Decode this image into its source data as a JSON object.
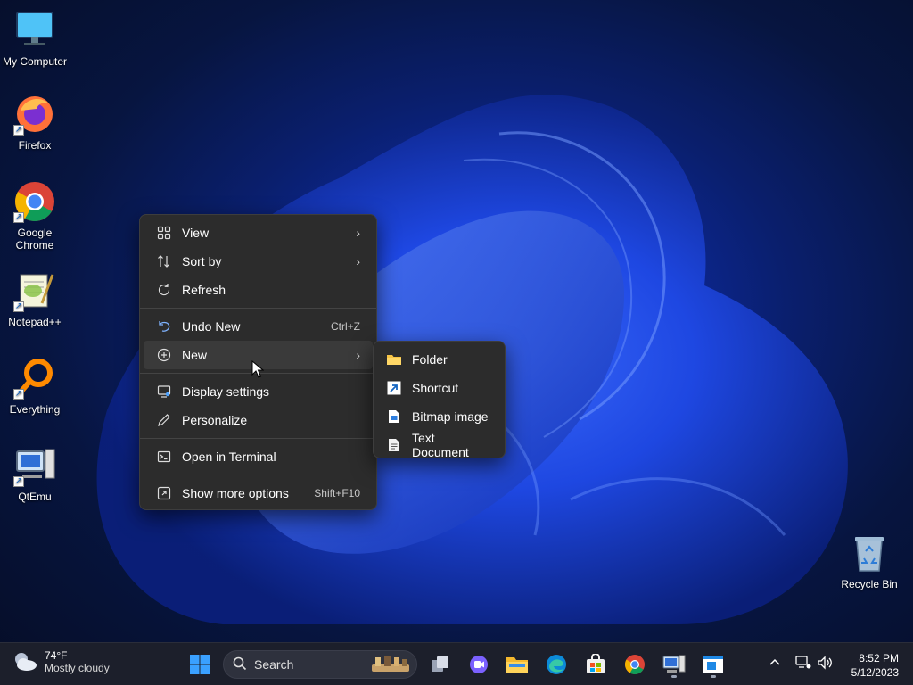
{
  "desktop": {
    "icons": [
      {
        "label": "My Computer"
      },
      {
        "label": "Firefox"
      },
      {
        "label": "Google Chrome"
      },
      {
        "label": "Notepad++"
      },
      {
        "label": "Everything"
      },
      {
        "label": "QtEmu"
      },
      {
        "label": "Recycle Bin"
      }
    ]
  },
  "context_menu": {
    "view": "View",
    "sort_by": "Sort by",
    "refresh": "Refresh",
    "undo_new": "Undo New",
    "undo_new_shortcut": "Ctrl+Z",
    "new": "New",
    "display_settings": "Display settings",
    "personalize": "Personalize",
    "open_terminal": "Open in Terminal",
    "show_more": "Show more options",
    "show_more_shortcut": "Shift+F10"
  },
  "new_submenu": {
    "folder": "Folder",
    "shortcut": "Shortcut",
    "bitmap": "Bitmap image",
    "text_document": "Text Document"
  },
  "taskbar": {
    "weather_temp": "74°F",
    "weather_condition": "Mostly cloudy",
    "search_placeholder": "Search",
    "time": "8:52 PM",
    "date": "5/12/2023"
  },
  "colors": {
    "menu_bg": "#2c2c2c",
    "taskbar_bg": "#1c1f2b",
    "accent": "#0078d4"
  }
}
